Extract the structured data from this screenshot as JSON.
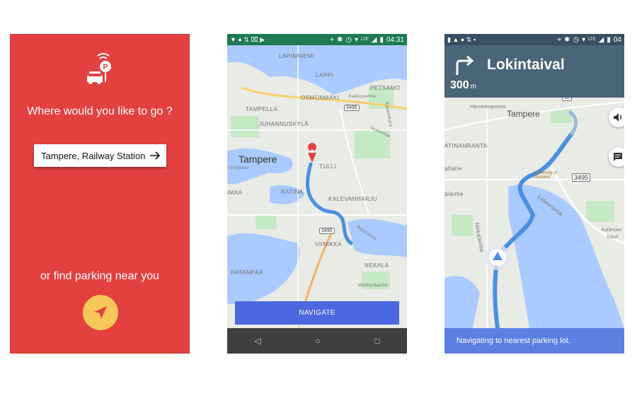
{
  "colors": {
    "brand_red": "#e34040",
    "button_yellow": "#f8c75a",
    "navigate_blue": "#4c68e0",
    "header_slate": "#4a6478",
    "footer_blue": "#5c7fe4",
    "route_blue": "#4a8fe2",
    "status_green": "#1d7a53"
  },
  "screen1": {
    "logo_icon": "car-parking-signal-icon",
    "question": "Where would you like to go ?",
    "destination": "Tampere, Railway Station",
    "destination_icon": "arrow-right-icon",
    "alt_text": "or find parking near you",
    "locate_icon": "navigation-arrow-icon"
  },
  "screen2": {
    "status": {
      "time": "04:31",
      "network": "LTE"
    },
    "map": {
      "labels": [
        "LAPINNIEMI",
        "LAPPI",
        "PETSAMO",
        "OSMONMÄKI",
        "Kekkosentie",
        "TAMPELLA",
        "JUHANNUSKYLÄ",
        "Tampere",
        "TULLI",
        "Itsenäisyydenkatu",
        "Iiliitykatu",
        "RATINA",
        "KALEVANHARJU",
        "IMAA",
        "Nekalantie",
        "VIINIKKA",
        "NEKALA",
        "HATANPÄÄ",
        "Manhyläantie",
        "Teiskontie",
        "Kaupinkatu"
      ],
      "shields": [
        "3495",
        "3495"
      ]
    },
    "navigate_label": "NAVIGATE",
    "nav_icons": [
      "back-icon",
      "home-icon",
      "recents-icon"
    ]
  },
  "screen3": {
    "status": {
      "time": "04",
      "network": "LTE"
    },
    "turn_icon": "turn-right-icon",
    "street": "Lokintaival",
    "distance": "300",
    "distance_unit": "m",
    "map": {
      "labels": [
        "Hämeenpuisto",
        "Tampere",
        "ATINANRANTA",
        "altatie",
        "University of Tampere",
        "äläntie",
        "Nekalantie",
        "Lidesranta",
        "Kalevan",
        "haut"
      ],
      "shield": "3495"
    },
    "sound_icon": "speaker-icon",
    "report_icon": "message-icon",
    "footer_text": "Navigating to nearest parking lot."
  }
}
